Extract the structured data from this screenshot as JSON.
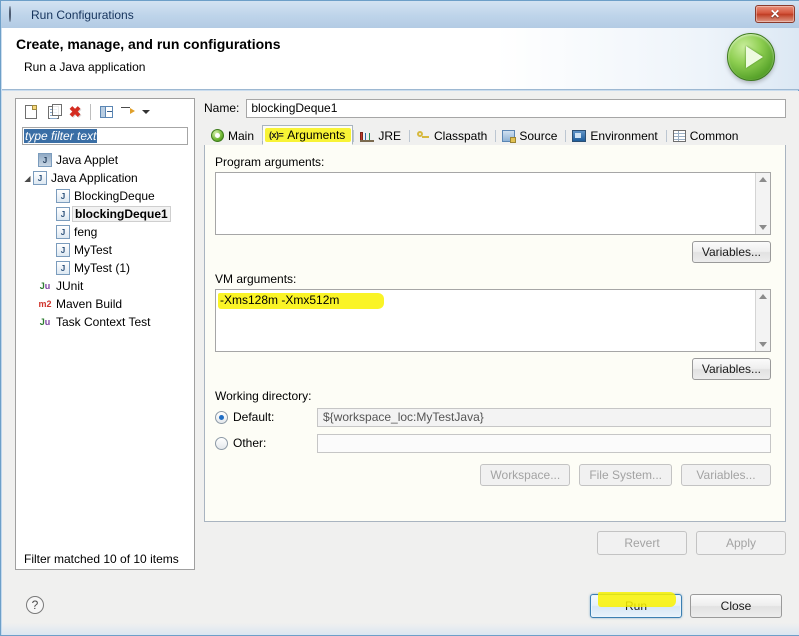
{
  "window": {
    "title": "Run Configurations",
    "close_label": "✕"
  },
  "header": {
    "title": "Create, manage, and run configurations",
    "subtitle": "Run a Java application",
    "badge_icon": "run-play-icon"
  },
  "left_panel": {
    "toolbar": [
      {
        "name": "new-configuration-icon",
        "title": "New launch configuration"
      },
      {
        "name": "duplicate-configuration-icon",
        "title": "Duplicate"
      },
      {
        "name": "delete-configuration-icon",
        "title": "Delete",
        "glyph": "✖"
      },
      {
        "name": "collapse-all-icon",
        "title": "Collapse All"
      },
      {
        "name": "filter-icon",
        "title": "Filter"
      },
      {
        "name": "chevron-down-icon",
        "title": "Menu"
      }
    ],
    "filter": {
      "value": "type filter text",
      "selected": true
    },
    "tree": [
      {
        "label": "Java Applet",
        "icon": "java-applet-icon",
        "depth": 1,
        "arrow": "",
        "selected": false
      },
      {
        "label": "Java Application",
        "icon": "java-application-icon",
        "depth": 1,
        "arrow": "◢",
        "selected": false
      },
      {
        "label": "BlockingDeque",
        "icon": "java-launch-icon",
        "depth": 2,
        "arrow": "",
        "selected": false
      },
      {
        "label": "blockingDeque1",
        "icon": "java-launch-icon",
        "depth": 2,
        "arrow": "",
        "selected": true
      },
      {
        "label": "feng",
        "icon": "java-launch-icon",
        "depth": 2,
        "arrow": "",
        "selected": false
      },
      {
        "label": "MyTest",
        "icon": "java-launch-icon",
        "depth": 2,
        "arrow": "",
        "selected": false
      },
      {
        "label": "MyTest (1)",
        "icon": "java-launch-icon",
        "depth": 2,
        "arrow": "",
        "selected": false
      },
      {
        "label": "JUnit",
        "icon": "junit-icon",
        "depth": 1,
        "arrow": "",
        "selected": false
      },
      {
        "label": "Maven Build",
        "icon": "maven-icon",
        "depth": 1,
        "arrow": "",
        "selected": false
      },
      {
        "label": "Task Context Test",
        "icon": "junit-icon",
        "depth": 1,
        "arrow": "",
        "selected": false
      }
    ],
    "status": "Filter matched 10 of 10 items"
  },
  "right_panel": {
    "name_label": "Name:",
    "name_value": "blockingDeque1",
    "tabs": [
      {
        "label": "Main",
        "icon": "main-icon",
        "active": false,
        "highlighted": false
      },
      {
        "label": "Arguments",
        "icon": "arguments-icon",
        "icon_text": "(x)=",
        "active": true,
        "highlighted": true
      },
      {
        "label": "JRE",
        "icon": "jre-icon",
        "active": false,
        "highlighted": false
      },
      {
        "label": "Classpath",
        "icon": "classpath-icon",
        "active": false,
        "highlighted": false
      },
      {
        "label": "Source",
        "icon": "source-icon",
        "active": false,
        "highlighted": false
      },
      {
        "label": "Environment",
        "icon": "environment-icon",
        "active": false,
        "highlighted": false
      },
      {
        "label": "Common",
        "icon": "common-icon",
        "active": false,
        "highlighted": false
      }
    ],
    "program_arguments": {
      "label": "Program arguments:",
      "value": "",
      "variables_button": "Variables..."
    },
    "vm_arguments": {
      "label": "VM arguments:",
      "value": "-Xms128m -Xmx512m",
      "highlighted": true,
      "variables_button": "Variables..."
    },
    "working_directory": {
      "label": "Working directory:",
      "default_label": "Default:",
      "default_selected": true,
      "default_value": "${workspace_loc:MyTestJava}",
      "other_label": "Other:",
      "other_selected": false,
      "other_value": "",
      "workspace_button": "Workspace...",
      "filesystem_button": "File System...",
      "variables_button": "Variables..."
    },
    "revert_button": "Revert",
    "apply_button": "Apply"
  },
  "footer": {
    "help_label": "?",
    "run_button": "Run",
    "close_button": "Close"
  },
  "colors": {
    "highlighter": "#f9f200",
    "selection_blue": "#3a6ea5",
    "accent_green": "#5aa52c",
    "close_red": "#bf3d23"
  }
}
